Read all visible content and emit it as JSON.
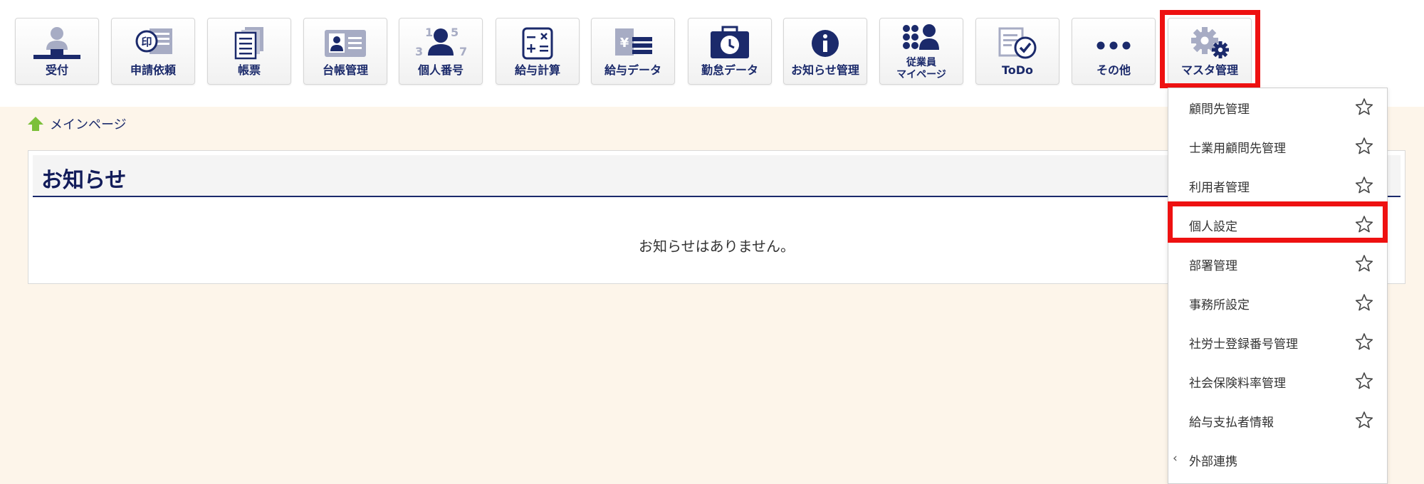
{
  "toolbar": {
    "buttons": [
      {
        "label": "受付",
        "icon": "reception-icon"
      },
      {
        "label": "申請依頼",
        "icon": "seal-request-icon"
      },
      {
        "label": "帳票",
        "icon": "forms-icon"
      },
      {
        "label": "台帳管理",
        "icon": "ledger-card-icon"
      },
      {
        "label": "個人番号",
        "icon": "personal-number-icon"
      },
      {
        "label": "給与計算",
        "icon": "calculator-icon"
      },
      {
        "label": "給与データ",
        "icon": "salary-data-icon"
      },
      {
        "label": "勤怠データ",
        "icon": "attendance-clock-icon"
      },
      {
        "label": "お知らせ管理",
        "icon": "info-icon"
      },
      {
        "label1": "従業員",
        "label2": "マイページ",
        "icon": "employee-mypage-icon"
      },
      {
        "label": "ToDo",
        "icon": "todo-check-icon"
      },
      {
        "label": "その他",
        "icon": "more-dots-icon"
      },
      {
        "label": "マスタ管理",
        "icon": "gears-icon"
      }
    ]
  },
  "breadcrumb": {
    "home_label": "メインページ"
  },
  "notice": {
    "title": "お知らせ",
    "empty_message": "お知らせはありません。"
  },
  "master_menu": {
    "items": [
      {
        "label": "顧問先管理"
      },
      {
        "label": "士業用顧問先管理"
      },
      {
        "label": "利用者管理"
      },
      {
        "label": "個人設定"
      },
      {
        "label": "部署管理"
      },
      {
        "label": "事務所設定"
      },
      {
        "label": "社労士登録番号管理"
      },
      {
        "label": "社会保険料率管理"
      },
      {
        "label": "給与支払者情報"
      }
    ],
    "submenu_label": "外部連携",
    "submenu_chevron": "‹"
  },
  "colors": {
    "brand_navy": "#1b2a6b",
    "icon_gray": "#a7acc4",
    "content_bg": "#fdf5ea",
    "highlight": "#ee1111",
    "home_green": "#7cc03a"
  }
}
